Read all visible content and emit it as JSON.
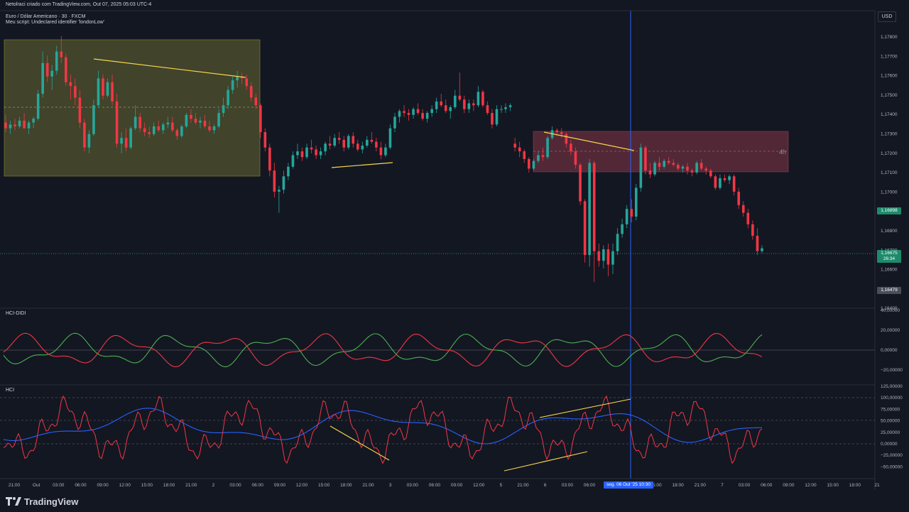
{
  "header": {
    "created_by": "Netolraci criado com TradingView.com, Out 07, 2025 05:03 UTC-4",
    "symbol": "Euro / Dólar Americano · 30 · FXCM",
    "script_error": "Meu script: Undeclared identifier 'londonLow'"
  },
  "currency_button": "USD",
  "colors": {
    "background": "#131722",
    "bull": "#26a69a",
    "bear": "#f23645",
    "yellow_box": "#4a4b2c",
    "pink_box": "#5a2a38",
    "trendline": "#f7d74d",
    "cursor_line": "#2962ff",
    "hci_red": "#f23645",
    "hci_green": "#4caf50",
    "hci_blue": "#2962ff",
    "hci_purple": "#b03fd6"
  },
  "price_axis": {
    "ticks": [
      "1,17800",
      "1,17700",
      "1,17600",
      "1,17500",
      "1,17400",
      "1,17300",
      "1,17200",
      "1,17100",
      "1,17000",
      "1,16900",
      "1,16800",
      "1,16700",
      "1,16600",
      "1,16500",
      "1,16400"
    ],
    "labels": {
      "green_level": "1,16898",
      "current": "1,16675",
      "countdown": "26:34",
      "low": "1,16479"
    }
  },
  "box_label": "4h",
  "pane1": {
    "title": "HCI-DIDI",
    "ticks": [
      "40,00000",
      "20,00000",
      "0,00000",
      "−20,00000"
    ]
  },
  "pane2": {
    "title": "HCI",
    "ticks": [
      "125,00000",
      "100,00000",
      "75,00000",
      "50,00000",
      "25,00000",
      "0,00000",
      "−25,00000",
      "−50,00000"
    ]
  },
  "time_axis": {
    "labels": [
      "21:00",
      "Out",
      "03:00",
      "06:00",
      "09:00",
      "12:00",
      "15:00",
      "18:00",
      "21:00",
      "2",
      "03:00",
      "06:00",
      "09:00",
      "12:00",
      "15:00",
      "18:00",
      "21:00",
      "3",
      "03:00",
      "06:00",
      "09:00",
      "12:00",
      "5",
      "21:00",
      "6",
      "03:00",
      "06:00",
      "09:00",
      "12:00",
      "15:00",
      "18:00",
      "21:00",
      "7",
      "03:00",
      "06:00",
      "09:00",
      "12:00",
      "15:00",
      "18:00",
      "21"
    ],
    "highlight": "seg. 06 Out '25   10:30"
  },
  "brand": "TradingView",
  "chart_data": {
    "type": "candlestick",
    "title": "Euro / Dólar Americano · 30 · FXCM",
    "interval": "30",
    "y_range": [
      1.164,
      1.1785
    ],
    "grid": false,
    "last_price": 1.16675,
    "candles": [
      [
        1.1733,
        1.1737,
        1.1728,
        1.173
      ],
      [
        1.173,
        1.1734,
        1.1727,
        1.1732
      ],
      [
        1.1732,
        1.1735,
        1.1729,
        1.1731
      ],
      [
        1.1731,
        1.1736,
        1.173,
        1.1734
      ],
      [
        1.1734,
        1.1738,
        1.173,
        1.173
      ],
      [
        1.173,
        1.1734,
        1.1727,
        1.1733
      ],
      [
        1.1733,
        1.1736,
        1.173,
        1.1735
      ],
      [
        1.1735,
        1.175,
        1.1734,
        1.1748
      ],
      [
        1.1748,
        1.177,
        1.1746,
        1.1764
      ],
      [
        1.1764,
        1.1768,
        1.1754,
        1.1757
      ],
      [
        1.1757,
        1.1763,
        1.175,
        1.176
      ],
      [
        1.176,
        1.1773,
        1.1758,
        1.177
      ],
      [
        1.177,
        1.1778,
        1.1764,
        1.1767
      ],
      [
        1.1767,
        1.1769,
        1.1752,
        1.1754
      ],
      [
        1.1754,
        1.1758,
        1.1745,
        1.1752
      ],
      [
        1.1752,
        1.1756,
        1.1742,
        1.1746
      ],
      [
        1.1746,
        1.175,
        1.173,
        1.1733
      ],
      [
        1.1733,
        1.1735,
        1.1718,
        1.172
      ],
      [
        1.172,
        1.1729,
        1.1717,
        1.1727
      ],
      [
        1.1727,
        1.1745,
        1.1726,
        1.1742
      ],
      [
        1.1742,
        1.176,
        1.1741,
        1.1756
      ],
      [
        1.1756,
        1.1758,
        1.1745,
        1.1747
      ],
      [
        1.1747,
        1.1756,
        1.1746,
        1.1754
      ],
      [
        1.1754,
        1.1758,
        1.1742,
        1.1744
      ],
      [
        1.1744,
        1.1748,
        1.172,
        1.1722
      ],
      [
        1.1722,
        1.1728,
        1.1717,
        1.1725
      ],
      [
        1.1725,
        1.173,
        1.1718,
        1.172
      ],
      [
        1.172,
        1.1731,
        1.1719,
        1.173
      ],
      [
        1.173,
        1.1742,
        1.1729,
        1.1736
      ],
      [
        1.1736,
        1.1738,
        1.1728,
        1.173
      ],
      [
        1.173,
        1.1733,
        1.1726,
        1.1728
      ],
      [
        1.1728,
        1.1731,
        1.1725,
        1.1727
      ],
      [
        1.1727,
        1.1733,
        1.1726,
        1.1731
      ],
      [
        1.1731,
        1.1734,
        1.1728,
        1.1729
      ],
      [
        1.1729,
        1.1733,
        1.1727,
        1.1732
      ],
      [
        1.1732,
        1.1736,
        1.173,
        1.1733
      ],
      [
        1.1733,
        1.1736,
        1.1728,
        1.1729
      ],
      [
        1.1729,
        1.173,
        1.1724,
        1.1726
      ],
      [
        1.1726,
        1.1732,
        1.1725,
        1.1731
      ],
      [
        1.1731,
        1.1738,
        1.173,
        1.1737
      ],
      [
        1.1737,
        1.174,
        1.1733,
        1.1735
      ],
      [
        1.1735,
        1.1738,
        1.1732,
        1.1733
      ],
      [
        1.1733,
        1.1736,
        1.173,
        1.1734
      ],
      [
        1.1734,
        1.1737,
        1.173,
        1.1731
      ],
      [
        1.1731,
        1.1734,
        1.1728,
        1.1729
      ],
      [
        1.1729,
        1.1732,
        1.1727,
        1.1731
      ],
      [
        1.1731,
        1.174,
        1.173,
        1.1738
      ],
      [
        1.1738,
        1.1746,
        1.1736,
        1.1742
      ],
      [
        1.1742,
        1.1752,
        1.174,
        1.175
      ],
      [
        1.175,
        1.1757,
        1.1748,
        1.1755
      ],
      [
        1.1755,
        1.176,
        1.1751,
        1.1757
      ],
      [
        1.1757,
        1.1759,
        1.1753,
        1.1756
      ],
      [
        1.1756,
        1.1758,
        1.175,
        1.1752
      ],
      [
        1.1752,
        1.1754,
        1.1744,
        1.1746
      ],
      [
        1.1746,
        1.1748,
        1.174,
        1.1742
      ],
      [
        1.1742,
        1.1743,
        1.1725,
        1.1728
      ],
      [
        1.1728,
        1.173,
        1.1718,
        1.172
      ],
      [
        1.172,
        1.1722,
        1.1705,
        1.1708
      ],
      [
        1.1708,
        1.1712,
        1.1694,
        1.1697
      ],
      [
        1.1697,
        1.17,
        1.1686,
        1.1698
      ],
      [
        1.1698,
        1.1708,
        1.1696,
        1.1705
      ],
      [
        1.1705,
        1.1712,
        1.1703,
        1.171
      ],
      [
        1.171,
        1.1718,
        1.1709,
        1.1716
      ],
      [
        1.1716,
        1.1722,
        1.1714,
        1.1718
      ],
      [
        1.1718,
        1.172,
        1.1713,
        1.1715
      ],
      [
        1.1715,
        1.1722,
        1.1714,
        1.172
      ],
      [
        1.172,
        1.1724,
        1.1717,
        1.1719
      ],
      [
        1.1719,
        1.1721,
        1.1714,
        1.1716
      ],
      [
        1.1716,
        1.172,
        1.1714,
        1.1718
      ],
      [
        1.1718,
        1.1723,
        1.1716,
        1.1722
      ],
      [
        1.1722,
        1.1726,
        1.1719,
        1.1721
      ],
      [
        1.1721,
        1.1727,
        1.172,
        1.1725
      ],
      [
        1.1725,
        1.1728,
        1.1722,
        1.1724
      ],
      [
        1.1724,
        1.1726,
        1.1718,
        1.172
      ],
      [
        1.172,
        1.1727,
        1.1719,
        1.1726
      ],
      [
        1.1726,
        1.1728,
        1.172,
        1.1722
      ],
      [
        1.1722,
        1.1724,
        1.1718,
        1.1719
      ],
      [
        1.1719,
        1.1723,
        1.1717,
        1.1721
      ],
      [
        1.1721,
        1.1726,
        1.172,
        1.1724
      ],
      [
        1.1724,
        1.1728,
        1.1722,
        1.1723
      ],
      [
        1.1723,
        1.1725,
        1.1718,
        1.172
      ],
      [
        1.172,
        1.1723,
        1.1714,
        1.1716
      ],
      [
        1.1716,
        1.1722,
        1.1715,
        1.172
      ],
      [
        1.172,
        1.1732,
        1.1719,
        1.173
      ],
      [
        1.173,
        1.1738,
        1.1728,
        1.1736
      ],
      [
        1.1736,
        1.174,
        1.1733,
        1.1739
      ],
      [
        1.1739,
        1.1742,
        1.1736,
        1.1738
      ],
      [
        1.1738,
        1.174,
        1.1734,
        1.1737
      ],
      [
        1.1737,
        1.1741,
        1.1735,
        1.174
      ],
      [
        1.174,
        1.1743,
        1.1737,
        1.1738
      ],
      [
        1.1738,
        1.174,
        1.1734,
        1.1735
      ],
      [
        1.1735,
        1.1739,
        1.1733,
        1.1738
      ],
      [
        1.1738,
        1.1742,
        1.1736,
        1.174
      ],
      [
        1.174,
        1.1746,
        1.1738,
        1.1744
      ],
      [
        1.1744,
        1.1748,
        1.1741,
        1.1742
      ],
      [
        1.1742,
        1.1745,
        1.1738,
        1.1739
      ],
      [
        1.1739,
        1.1742,
        1.1735,
        1.1741
      ],
      [
        1.1741,
        1.175,
        1.174,
        1.1747
      ],
      [
        1.1747,
        1.1759,
        1.1744,
        1.1745
      ],
      [
        1.1745,
        1.1747,
        1.1738,
        1.174
      ],
      [
        1.174,
        1.1745,
        1.1738,
        1.1743
      ],
      [
        1.1743,
        1.1745,
        1.1739,
        1.1742
      ],
      [
        1.1742,
        1.1752,
        1.1741,
        1.1749
      ],
      [
        1.1749,
        1.175,
        1.1741,
        1.1742
      ],
      [
        1.1742,
        1.1744,
        1.1737,
        1.1738
      ],
      [
        1.1738,
        1.174,
        1.173,
        1.1732
      ],
      [
        1.1732,
        1.1742,
        1.1731,
        1.174
      ],
      [
        1.174,
        1.1742,
        1.1738,
        1.174
      ],
      [
        1.174,
        1.1743,
        1.1738,
        1.1741
      ],
      [
        1.1741,
        1.1743,
        1.1739,
        1.1742
      ],
      [
        1.1722,
        1.1725,
        1.1718,
        1.172
      ],
      [
        1.172,
        1.1723,
        1.1715,
        1.1718
      ],
      [
        1.1718,
        1.1719,
        1.1712,
        1.1714
      ],
      [
        1.1714,
        1.1715,
        1.1707,
        1.1709
      ],
      [
        1.1709,
        1.1714,
        1.1708,
        1.1713
      ],
      [
        1.1713,
        1.1718,
        1.1712,
        1.1716
      ],
      [
        1.1716,
        1.172,
        1.1713,
        1.1715
      ],
      [
        1.1715,
        1.1726,
        1.1714,
        1.1725
      ],
      [
        1.1725,
        1.1731,
        1.1724,
        1.1729
      ],
      [
        1.1729,
        1.173,
        1.1726,
        1.1728
      ],
      [
        1.1728,
        1.173,
        1.1725,
        1.1727
      ],
      [
        1.1727,
        1.1728,
        1.172,
        1.1722
      ],
      [
        1.1722,
        1.1724,
        1.1716,
        1.1718
      ],
      [
        1.1718,
        1.172,
        1.1709,
        1.1711
      ],
      [
        1.1711,
        1.1712,
        1.169,
        1.1692
      ],
      [
        1.1692,
        1.1693,
        1.166,
        1.1664
      ],
      [
        1.1664,
        1.1714,
        1.1658,
        1.1712
      ],
      [
        1.1712,
        1.1713,
        1.165,
        1.1666
      ],
      [
        1.1666,
        1.167,
        1.1658,
        1.1661
      ],
      [
        1.1661,
        1.1669,
        1.1657,
        1.1667
      ],
      [
        1.1667,
        1.167,
        1.1653,
        1.1659
      ],
      [
        1.1659,
        1.167,
        1.1654,
        1.1666
      ],
      [
        1.1666,
        1.1678,
        1.1664,
        1.1675
      ],
      [
        1.1675,
        1.1683,
        1.1673,
        1.168
      ],
      [
        1.168,
        1.169,
        1.1678,
        1.1688
      ],
      [
        1.1688,
        1.1693,
        1.1681,
        1.1684
      ],
      [
        1.1684,
        1.1701,
        1.1682,
        1.1699
      ],
      [
        1.1699,
        1.1722,
        1.1697,
        1.172
      ],
      [
        1.172,
        1.1721,
        1.1706,
        1.1708
      ],
      [
        1.1708,
        1.1712,
        1.1704,
        1.1706
      ],
      [
        1.1706,
        1.1713,
        1.1705,
        1.1712
      ],
      [
        1.1712,
        1.1715,
        1.1708,
        1.171
      ],
      [
        1.171,
        1.1714,
        1.1709,
        1.1713
      ],
      [
        1.1713,
        1.1715,
        1.1711,
        1.1712
      ],
      [
        1.1712,
        1.1714,
        1.171,
        1.1711
      ],
      [
        1.1711,
        1.1712,
        1.1708,
        1.1709
      ],
      [
        1.1709,
        1.1711,
        1.1707,
        1.171
      ],
      [
        1.171,
        1.1712,
        1.1706,
        1.1708
      ],
      [
        1.1708,
        1.1709,
        1.1705,
        1.1707
      ],
      [
        1.1707,
        1.1713,
        1.1706,
        1.1712
      ],
      [
        1.1712,
        1.1714,
        1.1708,
        1.1709
      ],
      [
        1.1709,
        1.171,
        1.1706,
        1.1708
      ],
      [
        1.1708,
        1.1709,
        1.1704,
        1.1705
      ],
      [
        1.1705,
        1.1706,
        1.1698,
        1.1699
      ],
      [
        1.1699,
        1.1706,
        1.1698,
        1.1704
      ],
      [
        1.1704,
        1.1706,
        1.1702,
        1.1703
      ],
      [
        1.1703,
        1.1706,
        1.1701,
        1.1705
      ],
      [
        1.1705,
        1.1706,
        1.1695,
        1.1697
      ],
      [
        1.1697,
        1.1699,
        1.1688,
        1.169
      ],
      [
        1.169,
        1.1692,
        1.1684,
        1.1686
      ],
      [
        1.1686,
        1.1688,
        1.1678,
        1.168
      ],
      [
        1.168,
        1.1682,
        1.1672,
        1.1674
      ],
      [
        1.1674,
        1.1678,
        1.1664,
        1.1666
      ],
      [
        1.1666,
        1.1669,
        1.1665,
        1.16675
      ]
    ]
  }
}
